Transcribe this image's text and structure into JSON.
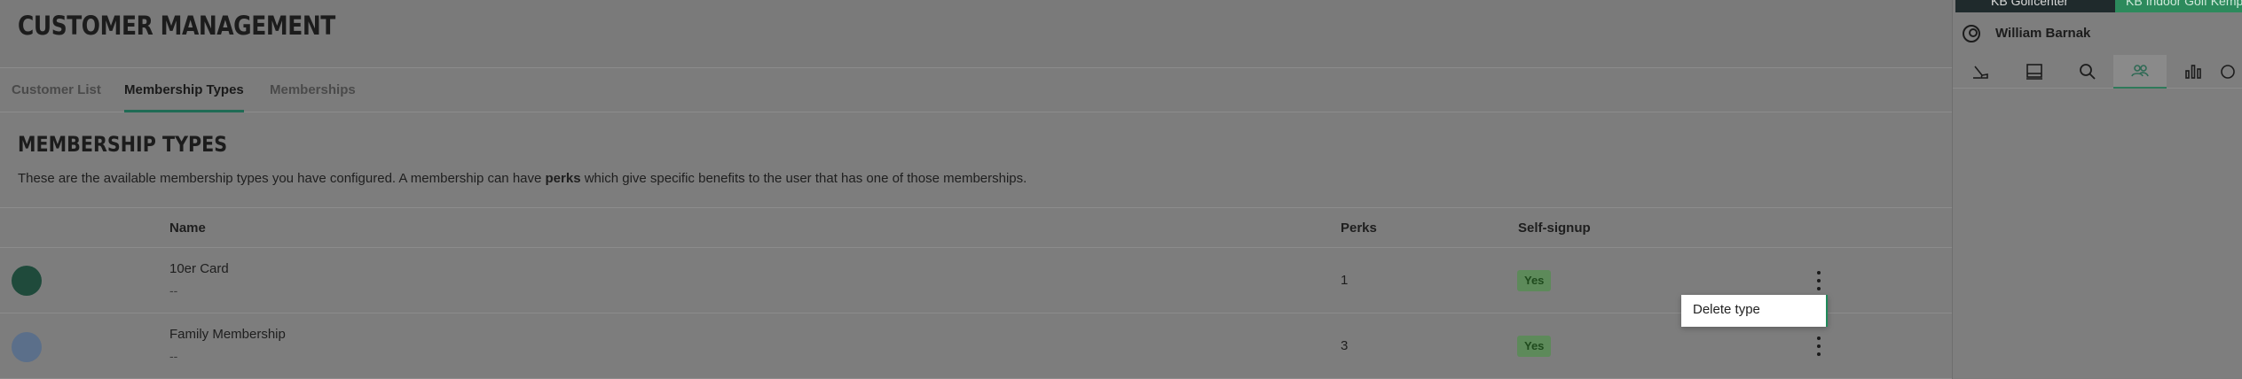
{
  "page": {
    "title": "CUSTOMER MANAGEMENT"
  },
  "tabs": [
    {
      "label": "Customer List"
    },
    {
      "label": "Membership Types"
    },
    {
      "label": "Memberships"
    }
  ],
  "section": {
    "title": "MEMBERSHIP TYPES",
    "desc_before": "These are the available membership types you have configured. A membership can have ",
    "desc_bold": "perks",
    "desc_after": " which give specific benefits to the user that has one of those memberships."
  },
  "table": {
    "headers": {
      "name": "Name",
      "perks": "Perks",
      "self_signup": "Self-signup"
    },
    "rows": [
      {
        "color": "#1f4a3b",
        "name": "10er Card",
        "sub": "--",
        "perks": "1",
        "self_signup": "Yes"
      },
      {
        "color": "#5b6f8a",
        "name": "Family Membership",
        "sub": "--",
        "perks": "3",
        "self_signup": "Yes"
      }
    ]
  },
  "context_menu": {
    "delete_label": "Delete type"
  },
  "sidebar": {
    "venues": [
      "KB Golfcenter",
      "KB Indoor Golf Kemp"
    ],
    "user_name": "William Barnak",
    "icons": [
      "golf-icon",
      "screen-icon",
      "search-icon",
      "customers-icon",
      "stats-icon",
      "more-icon"
    ]
  },
  "colors": {
    "accent": "#1f6b55",
    "badge_bg": "#5d8a5a",
    "overlay_gray": "#7d7d7d"
  }
}
